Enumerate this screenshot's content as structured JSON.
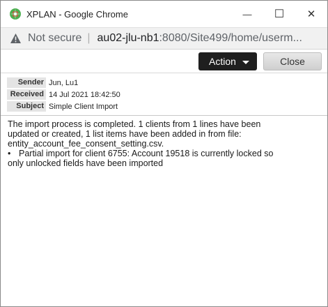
{
  "window": {
    "title": "XPLAN - Google Chrome",
    "minimize_glyph": "—",
    "maximize_glyph": "☐",
    "close_glyph": "✕"
  },
  "address": {
    "security_text": "Not secure",
    "url_host": "au02-jlu-nb1",
    "url_rest": ":8080/Site499/home/userm..."
  },
  "toolbar": {
    "action_label": "Action",
    "close_label": "Close"
  },
  "fields": {
    "sender_label": "Sender",
    "sender_value": "Jun, Lu1",
    "received_label": "Received",
    "received_value": "14 Jul 2021 18:42:50",
    "subject_label": "Subject",
    "subject_value": "Simple Client Import"
  },
  "body": {
    "line1": "The import process is completed. 1 clients from 1 lines have been",
    "line2": "updated or created, 1 list items have been added in from file:",
    "line3": "entity_account_fee_consent_setting.csv.",
    "bullet_glyph": "•",
    "bullet_text": "Partial import for client 6755: Account 19518 is currently locked so",
    "bullet_cont": "only unlocked fields have been imported"
  },
  "icons": {
    "app": "xplan-logo-icon",
    "warning": "warning-triangle-icon"
  },
  "colors": {
    "action_button": "#1f1f1f",
    "address_bar": "#f1f1f1",
    "label_bg": "#e4e4e4"
  }
}
